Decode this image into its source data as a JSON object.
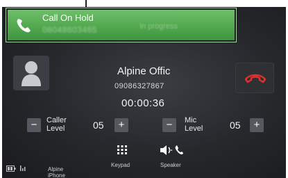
{
  "banner": {
    "title": "Call On Hold",
    "number": "08048603465",
    "status": "In progress"
  },
  "caller": {
    "name": "Alpine Offic",
    "number": "09086327867",
    "timer": "00:00:36"
  },
  "caller_level": {
    "label_line1": "Caller",
    "label_line2": "Level",
    "value": "05",
    "minus": "−",
    "plus": "+"
  },
  "mic_level": {
    "label_line1": "Mic",
    "label_line2": "Level",
    "value": "05",
    "minus": "−",
    "plus": "+"
  },
  "bottom": {
    "keypad_label": "Keypad",
    "speaker_label": "Speaker",
    "device_name": "Alpine iPhone"
  },
  "colors": {
    "banner_green": "#4fa64c",
    "end_call_red": "#e0302c",
    "background": "#25272b"
  },
  "icons": [
    "phone-icon",
    "person-icon",
    "end-call-icon",
    "keypad-icon",
    "speaker-phone-icon",
    "battery-icon",
    "signal-icon"
  ]
}
